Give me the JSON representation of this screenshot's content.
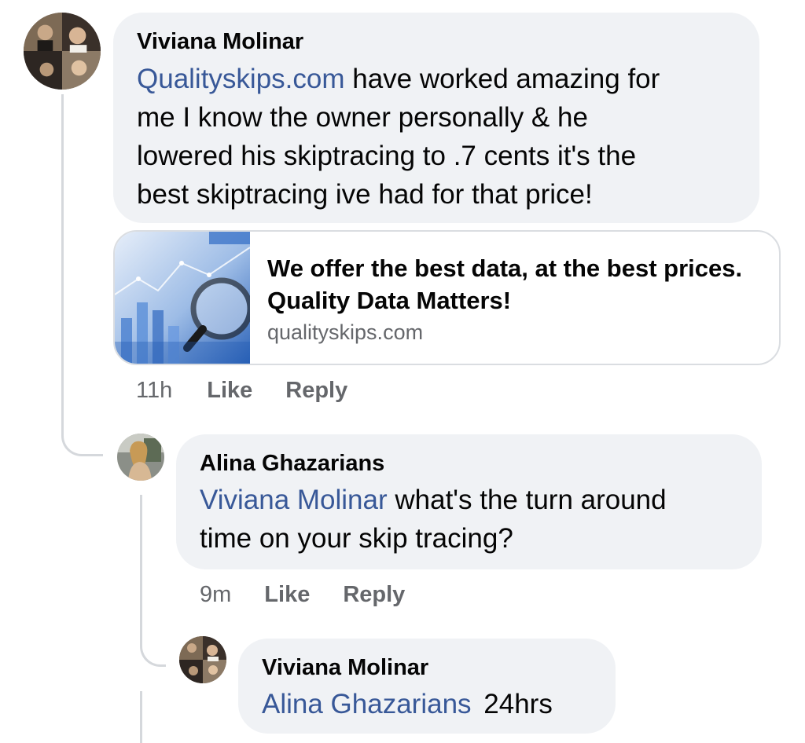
{
  "comments": [
    {
      "author": "Viviana Molinar",
      "mention": "Qualityskips.com",
      "text_line1_rest": " have worked amazing for",
      "text_line2": "me I know the owner personally & he",
      "text_line3": "lowered his skiptracing to .7 cents it's the",
      "text_line4": "best skiptracing ive had for that price!",
      "link_preview": {
        "title": "We offer the best data, at the best prices. Quality Data Matters!",
        "domain": "qualityskips.com"
      },
      "time": "11h",
      "like_label": "Like",
      "reply_label": "Reply"
    },
    {
      "author": "Alina Ghazarians",
      "mention": "Viviana Molinar",
      "text_line1_rest": " what's the turn around",
      "text_line2": "time on your skip tracing?",
      "time": "9m",
      "like_label": "Like",
      "reply_label": "Reply"
    },
    {
      "author": "Viviana Molinar",
      "mention": "Alina Ghazarians",
      "text_rest": "24hrs"
    }
  ],
  "colors": {
    "bubble": "#f0f2f5",
    "mention": "#385898",
    "meta": "#65676b",
    "thread_line": "#d5d8dc"
  }
}
